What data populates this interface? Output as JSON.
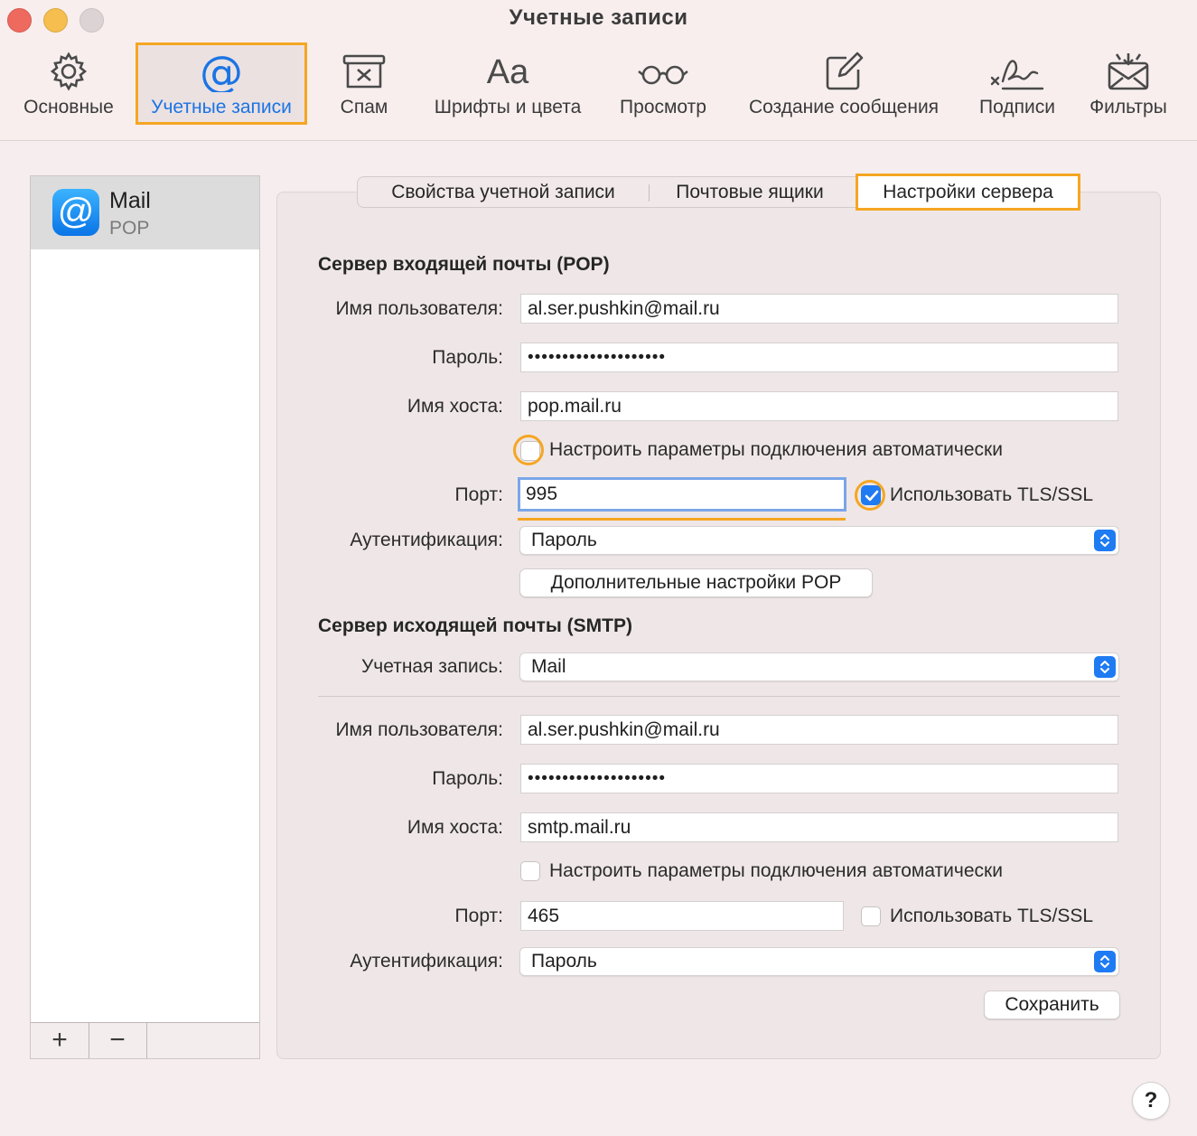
{
  "window": {
    "title": "Учетные записи"
  },
  "toolbar": {
    "items": [
      {
        "label": "Основные",
        "icon": "gear-icon"
      },
      {
        "label": "Учетные записи",
        "icon": "at-sign-icon"
      },
      {
        "label": "Спам",
        "icon": "junk-bin-icon"
      },
      {
        "label": "Шрифты и цвета",
        "icon": "fonts-icon",
        "glyph": "Aa"
      },
      {
        "label": "Просмотр",
        "icon": "glasses-icon"
      },
      {
        "label": "Создание сообщения",
        "icon": "compose-icon"
      },
      {
        "label": "Подписи",
        "icon": "signature-icon"
      },
      {
        "label": "Фильтры",
        "icon": "filter-envelope-icon"
      }
    ],
    "active": "Учетные записи",
    "accent": "#1b74e4",
    "highlight": "#f5a623"
  },
  "sidebar": {
    "account": {
      "name": "Mail",
      "type": "POP",
      "icon_glyph": "@"
    },
    "add_glyph": "+",
    "remove_glyph": "−"
  },
  "tabs": {
    "items": [
      "Свойства учетной записи",
      "Почтовые ящики",
      "Настройки сервера"
    ],
    "active": "Настройки сервера"
  },
  "incoming": {
    "title": "Сервер входящей почты (POP)",
    "username_label": "Имя пользователя:",
    "username": "al.ser.pushkin@mail.ru",
    "password_label": "Пароль:",
    "password": "••••••••••••••••••••",
    "host_label": "Имя хоста:",
    "host": "pop.mail.ru",
    "auto_label": "Настроить параметры подключения автоматически",
    "auto_checked": false,
    "port_label": "Порт:",
    "port": "995",
    "tls_label": "Использовать TLS/SSL",
    "tls_checked": true,
    "auth_label": "Аутентификация:",
    "auth": "Пароль",
    "advanced_button": "Дополнительные настройки POP"
  },
  "outgoing": {
    "title": "Сервер исходящей почты (SMTP)",
    "account_label": "Учетная запись:",
    "account": "Mail",
    "username_label": "Имя пользователя:",
    "username": "al.ser.pushkin@mail.ru",
    "password_label": "Пароль:",
    "password": "••••••••••••••••••••",
    "host_label": "Имя хоста:",
    "host": "smtp.mail.ru",
    "auto_label": "Настроить параметры подключения автоматически",
    "auto_checked": false,
    "port_label": "Порт:",
    "port": "465",
    "tls_label": "Использовать TLS/SSL",
    "tls_checked": false,
    "auth_label": "Аутентификация:",
    "auth": "Пароль",
    "save_button": "Сохранить"
  },
  "help": {
    "glyph": "?"
  }
}
